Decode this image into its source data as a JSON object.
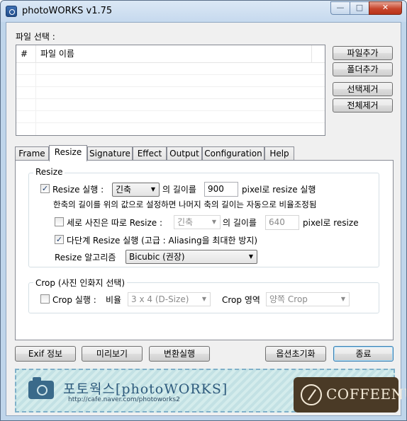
{
  "window": {
    "title": "photoWORKS v1.75",
    "controls": {
      "minimize": "—",
      "maximize": "□",
      "close": "✕"
    }
  },
  "file_section": {
    "label": "파일 선택 :",
    "columns": [
      "#",
      "파일 이름"
    ],
    "rows": []
  },
  "side_buttons": {
    "add_file": "파일추가",
    "add_folder": "폴더추가",
    "remove_selected": "선택제거",
    "remove_all": "전체제거"
  },
  "tabs": [
    {
      "label": "Frame",
      "active": false
    },
    {
      "label": "Resize",
      "active": true
    },
    {
      "label": "Signature",
      "active": false
    },
    {
      "label": "Effect",
      "active": false
    },
    {
      "label": "Output",
      "active": false
    },
    {
      "label": "Configuration",
      "active": false
    },
    {
      "label": "Help",
      "active": false
    }
  ],
  "resize": {
    "group_title": "Resize",
    "run_checkbox_checked": true,
    "run_label": "Resize 실행 :",
    "axis_value": "긴축",
    "length_label": "의 길이를",
    "length_value": "900",
    "pixel_suffix": "pixel로 resize 실행",
    "note": "한축의 길이를 위의 값으로 설정하면 나머지 축의 길이는 자동으로 비율조정됨",
    "portrait_checkbox_checked": false,
    "portrait_label": "세로 사진은 따로 Resize :",
    "portrait_axis_value": "긴축",
    "portrait_length_label": "의 길이를",
    "portrait_length_value": "640",
    "portrait_pixel_suffix": "pixel로 resize",
    "multistep_checkbox_checked": true,
    "multistep_label": "다단계 Resize 실행 (고급 : Aliasing을 최대한 방지)",
    "algorithm_label": "Resize 알고리즘",
    "algorithm_value": "Bicubic (권장)"
  },
  "crop": {
    "group_title": "Crop (사진 인화지 선택)",
    "checkbox_checked": false,
    "run_label": "Crop 실행 :",
    "ratio_label": "비율",
    "ratio_value": "3 x 4 (D-Size)",
    "area_label": "Crop 영역",
    "area_value": "양쪽 Crop"
  },
  "bottom_buttons": {
    "exif": "Exif 정보",
    "preview": "미리보기",
    "convert": "변환실행",
    "reset_options": "옵션초기화",
    "exit": "종료"
  },
  "banner": {
    "title": "포토웍스[photoWORKS]",
    "url": "http://cafe.naver.com/photoworks2",
    "sponsor": "COFFEENUT"
  },
  "icons": {
    "app": "camera-app-icon",
    "banner_camera": "camera-icon",
    "sponsor": "coffee-logo-icon"
  }
}
